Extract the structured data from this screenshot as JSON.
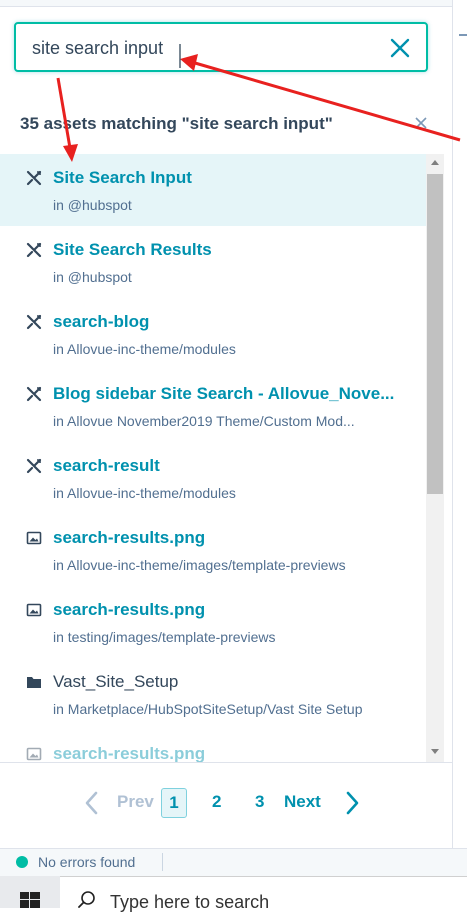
{
  "search": {
    "value": "site search input"
  },
  "results_header": "35 assets matching \"site search input\"",
  "results": [
    {
      "icon": "module-icon",
      "title": "Site Search Input",
      "path": "in @hubspot",
      "selected": true
    },
    {
      "icon": "module-icon",
      "title": "Site Search Results",
      "path": "in @hubspot"
    },
    {
      "icon": "module-icon",
      "title": "search-blog",
      "path": "in Allovue-inc-theme/modules"
    },
    {
      "icon": "module-icon",
      "title": "Blog sidebar Site Search - Allovue_Nove...",
      "path": "in Allovue November2019 Theme/Custom Mod..."
    },
    {
      "icon": "module-icon",
      "title": "search-result",
      "path": "in Allovue-inc-theme/modules"
    },
    {
      "icon": "image-icon",
      "title": "search-results.png",
      "path": "in Allovue-inc-theme/images/template-previews"
    },
    {
      "icon": "image-icon",
      "title": "search-results.png",
      "path": "in testing/images/template-previews"
    },
    {
      "icon": "folder-icon",
      "title": "Vast_Site_Setup",
      "path": "in Marketplace/HubSpotSiteSetup/Vast Site Setup"
    },
    {
      "icon": "image-icon",
      "title": "search-results.png",
      "path": ""
    }
  ],
  "pagination": {
    "prev": "Prev",
    "current": "1",
    "pages": [
      "2",
      "3"
    ],
    "next": "Next"
  },
  "status": {
    "text": "No errors found",
    "color": "#00bda5"
  },
  "taskbar": {
    "search_placeholder": "Type here to search"
  },
  "colors": {
    "accent": "#0091ae",
    "annotation": "#e8211f"
  }
}
